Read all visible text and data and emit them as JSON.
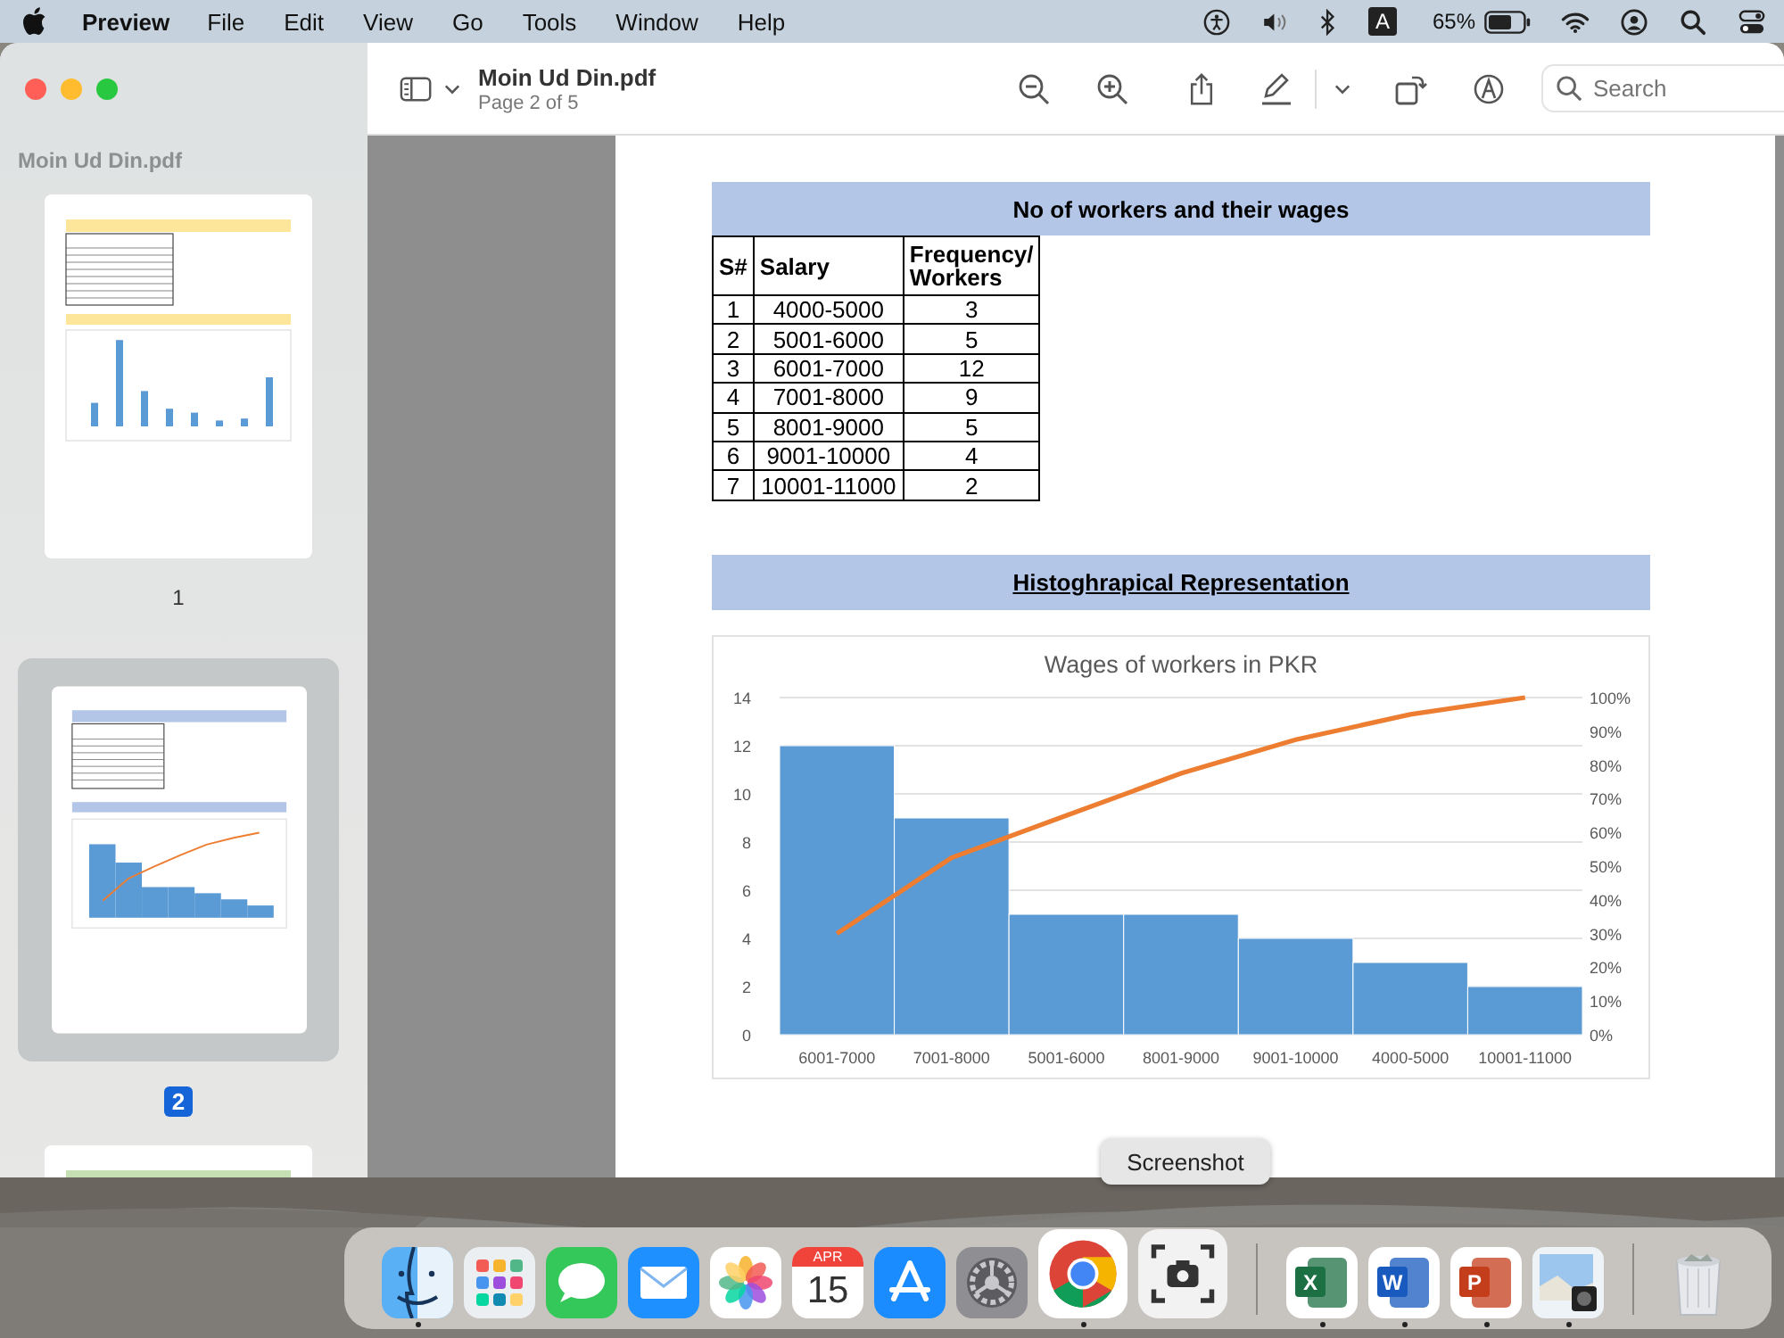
{
  "menu_bar": {
    "app_name": "Preview",
    "menus": [
      "File",
      "Edit",
      "View",
      "Go",
      "Tools",
      "Window",
      "Help"
    ],
    "input_source": "A",
    "battery_percent": "65%"
  },
  "toolbar": {
    "document_title": "Moin Ud Din.pdf",
    "page_indicator": "Page 2 of 5",
    "search": {
      "placeholder": "Search"
    }
  },
  "sidebar": {
    "title": "Moin Ud Din.pdf",
    "pages": [
      {
        "label": "1",
        "selected": false,
        "kind": "bars",
        "color": "#fde59a"
      },
      {
        "label": "2",
        "selected": true,
        "kind": "histogram",
        "color": "#b4c6e7"
      },
      {
        "selected": false,
        "kind": "text",
        "color": "#c6e0b4"
      }
    ]
  },
  "document": {
    "table_title": "No of workers and their wages",
    "table": {
      "columns": [
        "S#",
        "Salary",
        "Frequency/ Workers"
      ],
      "rows": [
        [
          "1",
          "4000-5000",
          "3"
        ],
        [
          "2",
          "5001-6000",
          "5"
        ],
        [
          "3",
          "6001-7000",
          "12"
        ],
        [
          "4",
          "7001-8000",
          "9"
        ],
        [
          "5",
          "8001-9000",
          "5"
        ],
        [
          "6",
          "9001-10000",
          "4"
        ],
        [
          "7",
          "10001-11000",
          "2"
        ]
      ]
    },
    "section_title": "Histoghrapical Representation",
    "chart_data": {
      "type": "bar",
      "title": "Wages of workers in PKR",
      "categories": [
        "6001-7000",
        "7001-8000",
        "5001-6000",
        "8001-9000",
        "9001-10000",
        "4000-5000",
        "10001-11000"
      ],
      "series": [
        {
          "color": "#5b9bd5",
          "values": [
            12,
            9,
            5,
            5,
            4,
            3,
            2
          ]
        },
        {
          "type": "line",
          "axis": "y2",
          "color": "#ed7d31",
          "values": [
            30,
            52.5,
            65,
            77.5,
            87.5,
            95,
            100
          ]
        }
      ],
      "ylim": [
        0,
        14
      ],
      "y2lim": [
        0,
        100
      ],
      "grid": true,
      "yticks": [
        0,
        2,
        4,
        6,
        8,
        10,
        12,
        14
      ],
      "y2ticks": [
        {
          "value": 0,
          "label": "0%"
        },
        {
          "value": 10,
          "label": "10%"
        },
        {
          "value": 20,
          "label": "20%"
        },
        {
          "value": 30,
          "label": "30%"
        },
        {
          "value": 40,
          "label": "40%"
        },
        {
          "value": 50,
          "label": "50%"
        },
        {
          "value": 60,
          "label": "60%"
        },
        {
          "value": 70,
          "label": "70%"
        },
        {
          "value": 80,
          "label": "80%"
        },
        {
          "value": 90,
          "label": "90%"
        },
        {
          "value": 100,
          "label": "100%"
        }
      ]
    }
  },
  "tooltip": "Screenshot",
  "dock": [
    {
      "kind": "finder",
      "running": true,
      "magnified": false
    },
    {
      "kind": "launchpad",
      "running": false,
      "magnified": false
    },
    {
      "kind": "messages",
      "running": false,
      "magnified": false
    },
    {
      "kind": "mail",
      "running": false,
      "magnified": false
    },
    {
      "kind": "photos",
      "running": false,
      "magnified": false
    },
    {
      "kind": "calendar",
      "running": false,
      "magnified": false,
      "month": "APR",
      "day": "15"
    },
    {
      "kind": "appstore",
      "running": false,
      "magnified": false
    },
    {
      "kind": "settings",
      "running": false,
      "magnified": false
    },
    {
      "kind": "browser",
      "running": true,
      "magnified": true
    },
    {
      "kind": "screenshot",
      "running": false,
      "magnified": true
    },
    {
      "kind": "separator"
    },
    {
      "kind": "spreadsheet",
      "running": true,
      "magnified": false,
      "glyph": "X"
    },
    {
      "kind": "document",
      "running": true,
      "magnified": false,
      "glyph": "W"
    },
    {
      "kind": "presentation",
      "running": true,
      "magnified": false,
      "glyph": "P"
    },
    {
      "kind": "viewer",
      "running": true,
      "magnified": false
    },
    {
      "kind": "separator"
    },
    {
      "kind": "trash",
      "running": false,
      "magnified": false
    }
  ]
}
